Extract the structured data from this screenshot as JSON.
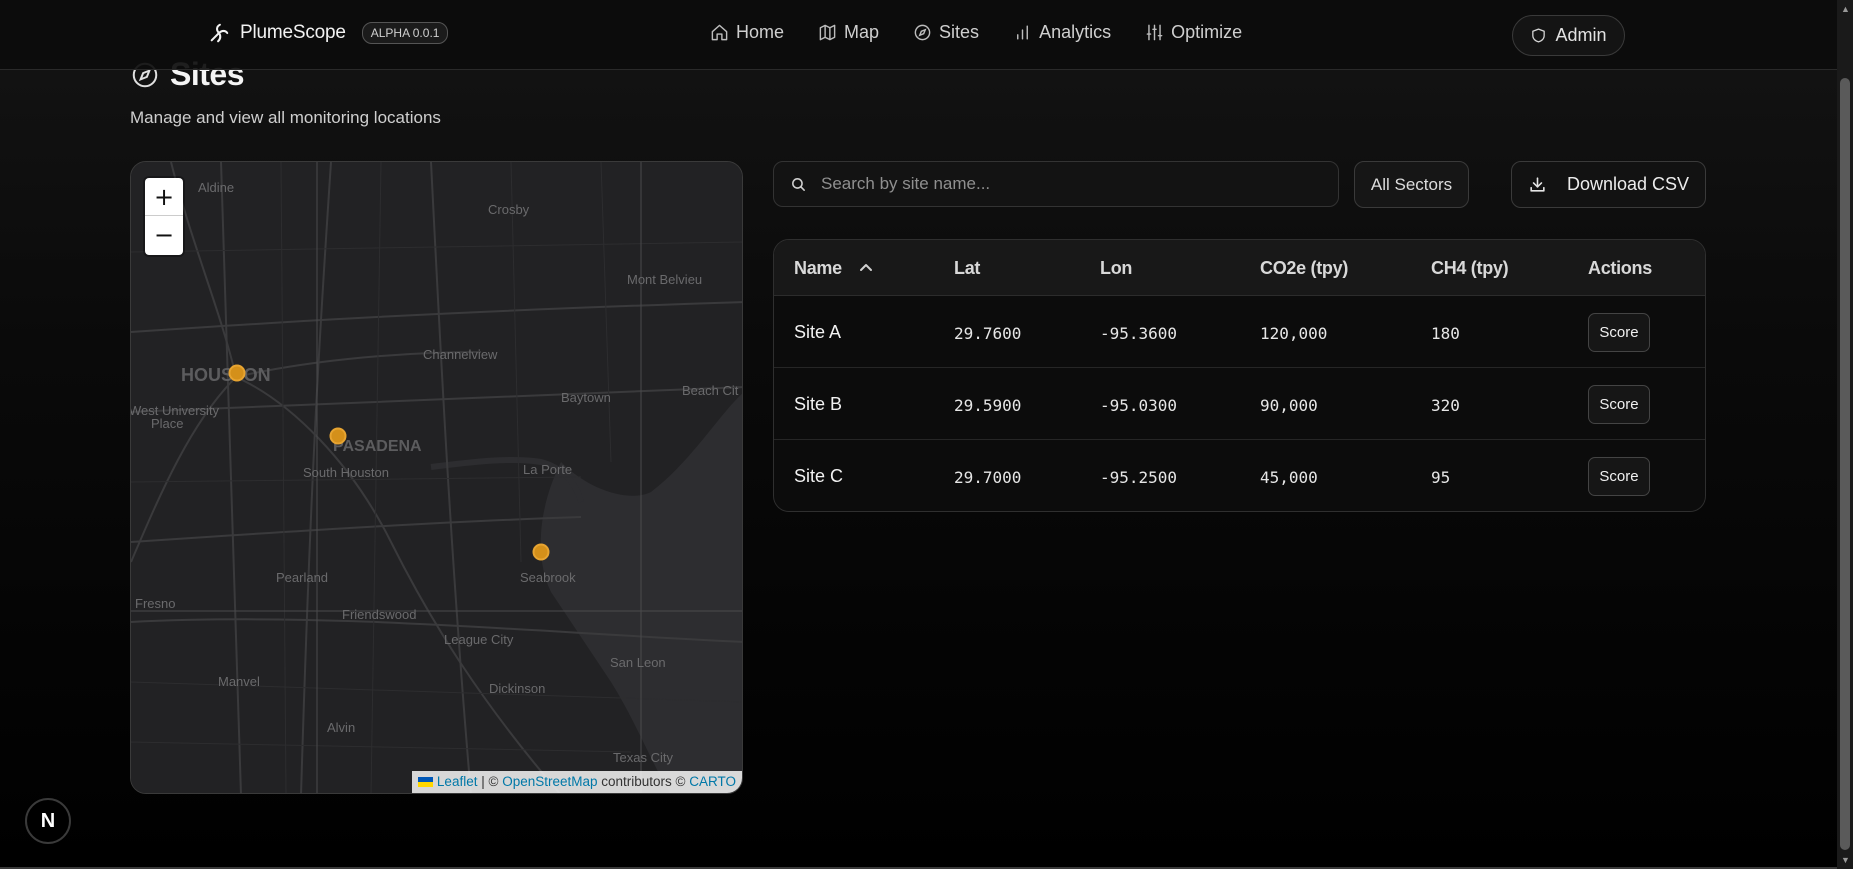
{
  "brand": {
    "name": "PlumeScope",
    "version": "ALPHA 0.0.1"
  },
  "nav": {
    "home": "Home",
    "map": "Map",
    "sites": "Sites",
    "analytics": "Analytics",
    "optimize": "Optimize",
    "admin": "Admin"
  },
  "page": {
    "title": "Sites",
    "subtitle": "Manage and view all monitoring locations"
  },
  "map": {
    "zoom_in": "+",
    "zoom_out": "−",
    "labels": {
      "aldine": "Aldine",
      "crosby": "Crosby",
      "mont_belvieu": "Mont Belvieu",
      "channelview": "Channelview",
      "houston": "HOUSTON",
      "west_university_1": "West University",
      "west_university_2": "Place",
      "baytown": "Baytown",
      "beach_city": "Beach Cit",
      "pasadena": "PASADENA",
      "south_houston": "South Houston",
      "la_porte": "La Porte",
      "pearland": "Pearland",
      "seabrook": "Seabrook",
      "fresno": "Fresno",
      "friendswood": "Friendswood",
      "league_city": "League City",
      "san_leon": "San Leon",
      "manvel": "Manvel",
      "dickinson": "Dickinson",
      "alvin": "Alvin",
      "texas_city": "Texas City"
    },
    "attribution": {
      "leaflet": "Leaflet",
      "sep": " | © ",
      "osm": "OpenStreetMap",
      "contributors": " contributors © ",
      "carto": "CARTO"
    },
    "marker_color": "#d4901a"
  },
  "toolbar": {
    "search_placeholder": "Search by site name...",
    "sector_filter": "All Sectors",
    "download_label": "Download CSV"
  },
  "table": {
    "headers": {
      "name": "Name",
      "lat": "Lat",
      "lon": "Lon",
      "co2e": "CO2e (tpy)",
      "ch4": "CH4 (tpy)",
      "actions": "Actions"
    },
    "rows": [
      {
        "name": "Site A",
        "lat": "29.7600",
        "lon": "-95.3600",
        "co2e": "120,000",
        "ch4": "180",
        "action": "Score"
      },
      {
        "name": "Site B",
        "lat": "29.5900",
        "lon": "-95.0300",
        "co2e": "90,000",
        "ch4": "320",
        "action": "Score"
      },
      {
        "name": "Site C",
        "lat": "29.7000",
        "lon": "-95.2500",
        "co2e": "45,000",
        "ch4": "95",
        "action": "Score"
      }
    ]
  },
  "dev_badge": "N"
}
